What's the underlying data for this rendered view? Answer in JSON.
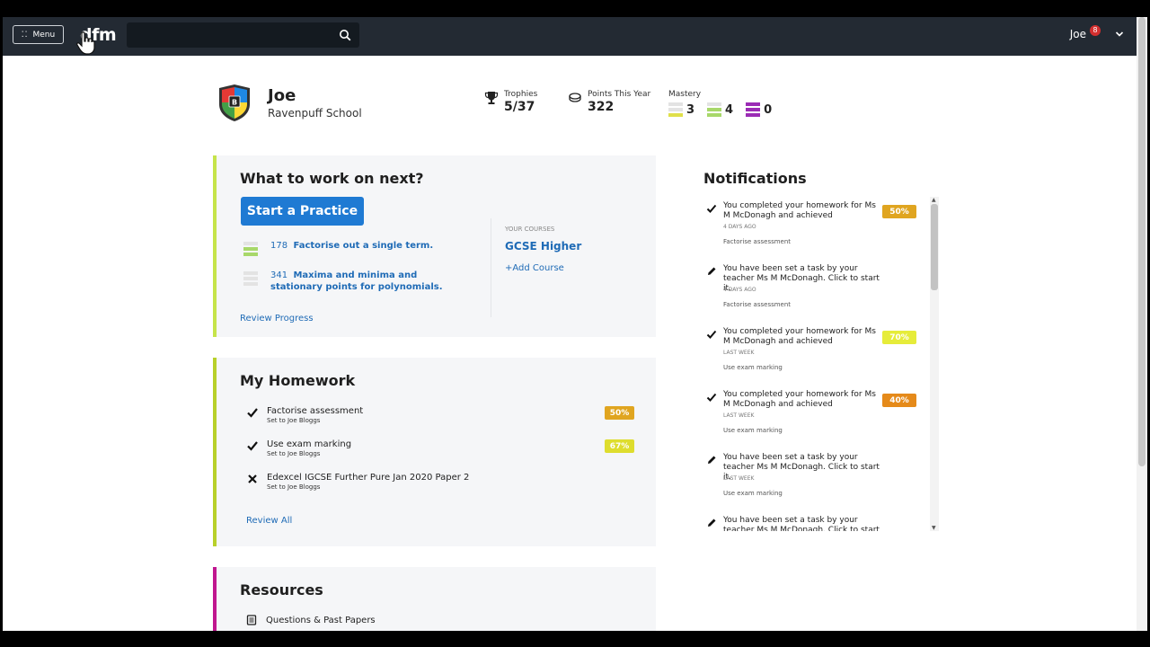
{
  "header": {
    "menu_label": "Menu",
    "logo": "dfm",
    "search_placeholder": "",
    "user_name": "Joe",
    "notification_count": "8"
  },
  "profile": {
    "name": "Joe",
    "school": "Ravenpuff School",
    "trophies_label": "Trophies",
    "trophies_value": "5/37",
    "points_label": "Points This Year",
    "points_value": "322",
    "mastery_label": "Mastery",
    "mastery": [
      {
        "count": "3",
        "color": "#e0e04a"
      },
      {
        "count": "4",
        "color": "#a8d86a"
      },
      {
        "count": "0",
        "color": "#9b2cb5"
      }
    ]
  },
  "work_next": {
    "title": "What to work on next?",
    "start_button": "Start a Practice",
    "items": [
      {
        "number": "178",
        "text": "Factorise out a single term."
      },
      {
        "number": "341",
        "text": "Maxima and minima and stationary points for polynomials."
      }
    ],
    "review_link": "Review Progress",
    "your_courses_label": "YOUR COURSES",
    "course": "GCSE Higher",
    "add_course": "+Add Course"
  },
  "homework": {
    "title": "My Homework",
    "items": [
      {
        "title": "Factorise assessment",
        "subtitle": "Set to Joe Bloggs",
        "status": "done",
        "percent": "50%",
        "color": "#e0a520"
      },
      {
        "title": "Use exam marking",
        "subtitle": "Set to Joe Bloggs",
        "status": "done",
        "percent": "67%",
        "color": "#dedd2e"
      },
      {
        "title": "Edexcel IGCSE Further Pure Jan 2020 Paper 2",
        "subtitle": "Set to Joe Bloggs",
        "status": "missed",
        "percent": "",
        "color": ""
      }
    ],
    "review_link": "Review All"
  },
  "resources": {
    "title": "Resources",
    "items": [
      {
        "label": "Questions & Past Papers"
      }
    ]
  },
  "notifications": {
    "title": "Notifications",
    "items": [
      {
        "type": "done",
        "text": "You completed your homework for Ms M McDonagh and achieved",
        "time": "4 DAYS AGO",
        "subject": "Factorise assessment",
        "percent": "50%",
        "color": "#e0a520"
      },
      {
        "type": "task",
        "text": "You have been set a task by your teacher Ms M McDonagh. Click to start it.",
        "time": "4 DAYS AGO",
        "subject": "Factorise assessment",
        "percent": "",
        "color": ""
      },
      {
        "type": "done",
        "text": "You completed your homework for Ms M McDonagh and achieved",
        "time": "LAST WEEK",
        "subject": "Use exam marking",
        "percent": "70%",
        "color": "#e6ec3a"
      },
      {
        "type": "done",
        "text": "You completed your homework for Ms M McDonagh and achieved",
        "time": "LAST WEEK",
        "subject": "Use exam marking",
        "percent": "40%",
        "color": "#e58a1a"
      },
      {
        "type": "task",
        "text": "You have been set a task by your teacher Ms M McDonagh. Click to start it.",
        "time": "LAST WEEK",
        "subject": "Use exam marking",
        "percent": "",
        "color": ""
      },
      {
        "type": "task",
        "text": "You have been set a task by your teacher Ms M McDonagh. Click to start it.",
        "time": "",
        "subject": "",
        "percent": "",
        "color": ""
      }
    ]
  }
}
